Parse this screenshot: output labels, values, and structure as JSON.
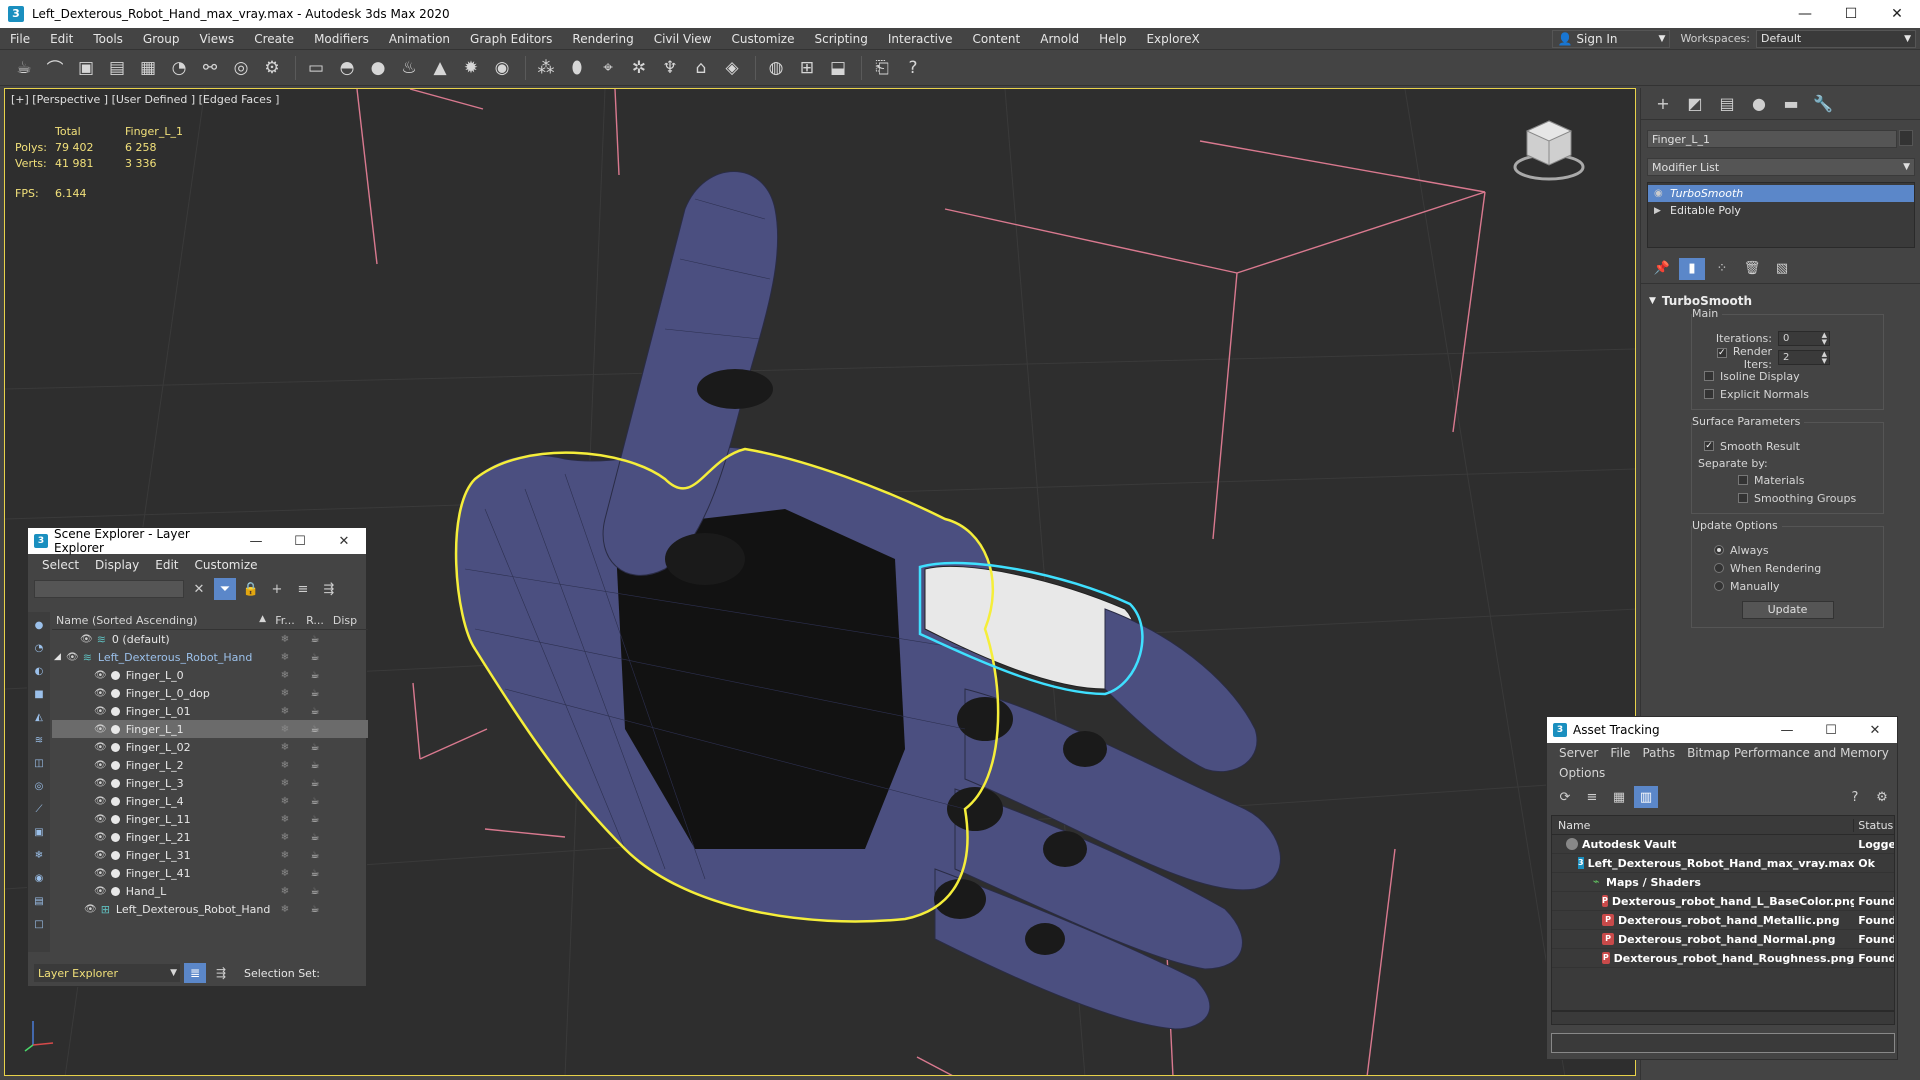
{
  "window": {
    "title": "Left_Dexterous_Robot_Hand_max_vray.max - Autodesk 3ds Max 2020",
    "minimize": "—",
    "maximize": "☐",
    "close": "✕"
  },
  "menubar": {
    "items": [
      "File",
      "Edit",
      "Tools",
      "Group",
      "Views",
      "Create",
      "Modifiers",
      "Animation",
      "Graph Editors",
      "Rendering",
      "Civil View",
      "Customize",
      "Scripting",
      "Interactive",
      "Content",
      "Arnold",
      "Help",
      "ExploreX"
    ],
    "sign_in": "Sign In",
    "workspaces_label": "Workspaces:",
    "workspace_value": "Default"
  },
  "viewport": {
    "label": "[+] [Perspective ] [User Defined ] [Edged Faces ]",
    "stats": {
      "total_label": "Total",
      "selected_label": "Finger_L_1",
      "polys_label": "Polys:",
      "polys_total": "79 402",
      "polys_selected": "6 258",
      "verts_label": "Verts:",
      "verts_total": "41 981",
      "verts_selected": "3 336",
      "fps_label": "FPS:",
      "fps_value": "6.144"
    }
  },
  "command_panel": {
    "object_name": "Finger_L_1",
    "modifier_list": "Modifier List",
    "stack": [
      {
        "label": "TurboSmooth",
        "selected": true
      },
      {
        "label": "Editable Poly",
        "selected": false
      }
    ],
    "rollout_title": "TurboSmooth",
    "main_group": "Main",
    "iterations_label": "Iterations:",
    "iterations_value": "0",
    "render_iters_label": "Render Iters:",
    "render_iters_value": "2",
    "isoline_display": "Isoline Display",
    "explicit_normals": "Explicit Normals",
    "surface_params": "Surface Parameters",
    "smooth_result": "Smooth Result",
    "separate_by": "Separate by:",
    "materials": "Materials",
    "smoothing_groups": "Smoothing Groups",
    "update_options": "Update Options",
    "always": "Always",
    "when_rendering": "When Rendering",
    "manually": "Manually",
    "update_button": "Update"
  },
  "scene_explorer": {
    "title": "Scene Explorer - Layer Explorer",
    "menu": [
      "Select",
      "Display",
      "Edit",
      "Customize"
    ],
    "columns": {
      "name": "Name (Sorted Ascending)",
      "frozen": "Fr...",
      "render": "R...",
      "display": "Disp"
    },
    "rows": [
      {
        "name": "0 (default)",
        "type": "layer",
        "indent": 1,
        "selected": false
      },
      {
        "name": "Left_Dexterous_Robot_Hand",
        "type": "layer-open",
        "indent": 0,
        "selected": false
      },
      {
        "name": "Finger_L_0",
        "type": "object",
        "indent": 2,
        "selected": false
      },
      {
        "name": "Finger_L_0_dop",
        "type": "object",
        "indent": 2,
        "selected": false
      },
      {
        "name": "Finger_L_01",
        "type": "object",
        "indent": 2,
        "selected": false
      },
      {
        "name": "Finger_L_1",
        "type": "object",
        "indent": 2,
        "selected": true
      },
      {
        "name": "Finger_L_02",
        "type": "object",
        "indent": 2,
        "selected": false
      },
      {
        "name": "Finger_L_2",
        "type": "object",
        "indent": 2,
        "selected": false
      },
      {
        "name": "Finger_L_3",
        "type": "object",
        "indent": 2,
        "selected": false
      },
      {
        "name": "Finger_L_4",
        "type": "object",
        "indent": 2,
        "selected": false
      },
      {
        "name": "Finger_L_11",
        "type": "object",
        "indent": 2,
        "selected": false
      },
      {
        "name": "Finger_L_21",
        "type": "object",
        "indent": 2,
        "selected": false
      },
      {
        "name": "Finger_L_31",
        "type": "object",
        "indent": 2,
        "selected": false
      },
      {
        "name": "Finger_L_41",
        "type": "object",
        "indent": 2,
        "selected": false
      },
      {
        "name": "Hand_L",
        "type": "object",
        "indent": 2,
        "selected": false
      },
      {
        "name": "Left_Dexterous_Robot_Hand",
        "type": "group",
        "indent": 2,
        "selected": false
      }
    ],
    "footer_mode": "Layer Explorer",
    "selection_set_label": "Selection Set:"
  },
  "asset_tracking": {
    "title": "Asset Tracking",
    "menu": [
      "Server",
      "File",
      "Paths",
      "Bitmap Performance and Memory",
      "Options"
    ],
    "columns": {
      "name": "Name",
      "status": "Status"
    },
    "rows": [
      {
        "name": "Autodesk Vault",
        "status": "Logged",
        "icon": "vault",
        "indent": 1
      },
      {
        "name": "Left_Dexterous_Robot_Hand_max_vray.max",
        "status": "Ok",
        "icon": "max",
        "indent": 2
      },
      {
        "name": "Maps / Shaders",
        "status": "",
        "icon": "folder",
        "indent": 3
      },
      {
        "name": "Dexterous_robot_hand_L_BaseColor.png",
        "status": "Found",
        "icon": "png",
        "indent": 4
      },
      {
        "name": "Dexterous_robot_hand_Metallic.png",
        "status": "Found",
        "icon": "png",
        "indent": 4
      },
      {
        "name": "Dexterous_robot_hand_Normal.png",
        "status": "Found",
        "icon": "png",
        "indent": 4
      },
      {
        "name": "Dexterous_robot_hand_Roughness.png",
        "status": "Found",
        "icon": "png",
        "indent": 4
      }
    ]
  },
  "colors": {
    "selection_yellow": "#f5ee3a",
    "highlight_cyan": "#3fe0ff",
    "mesh_blue": "#4b4f80",
    "grid_pink": "#d9798f",
    "accent_blue": "#5b87c9"
  }
}
